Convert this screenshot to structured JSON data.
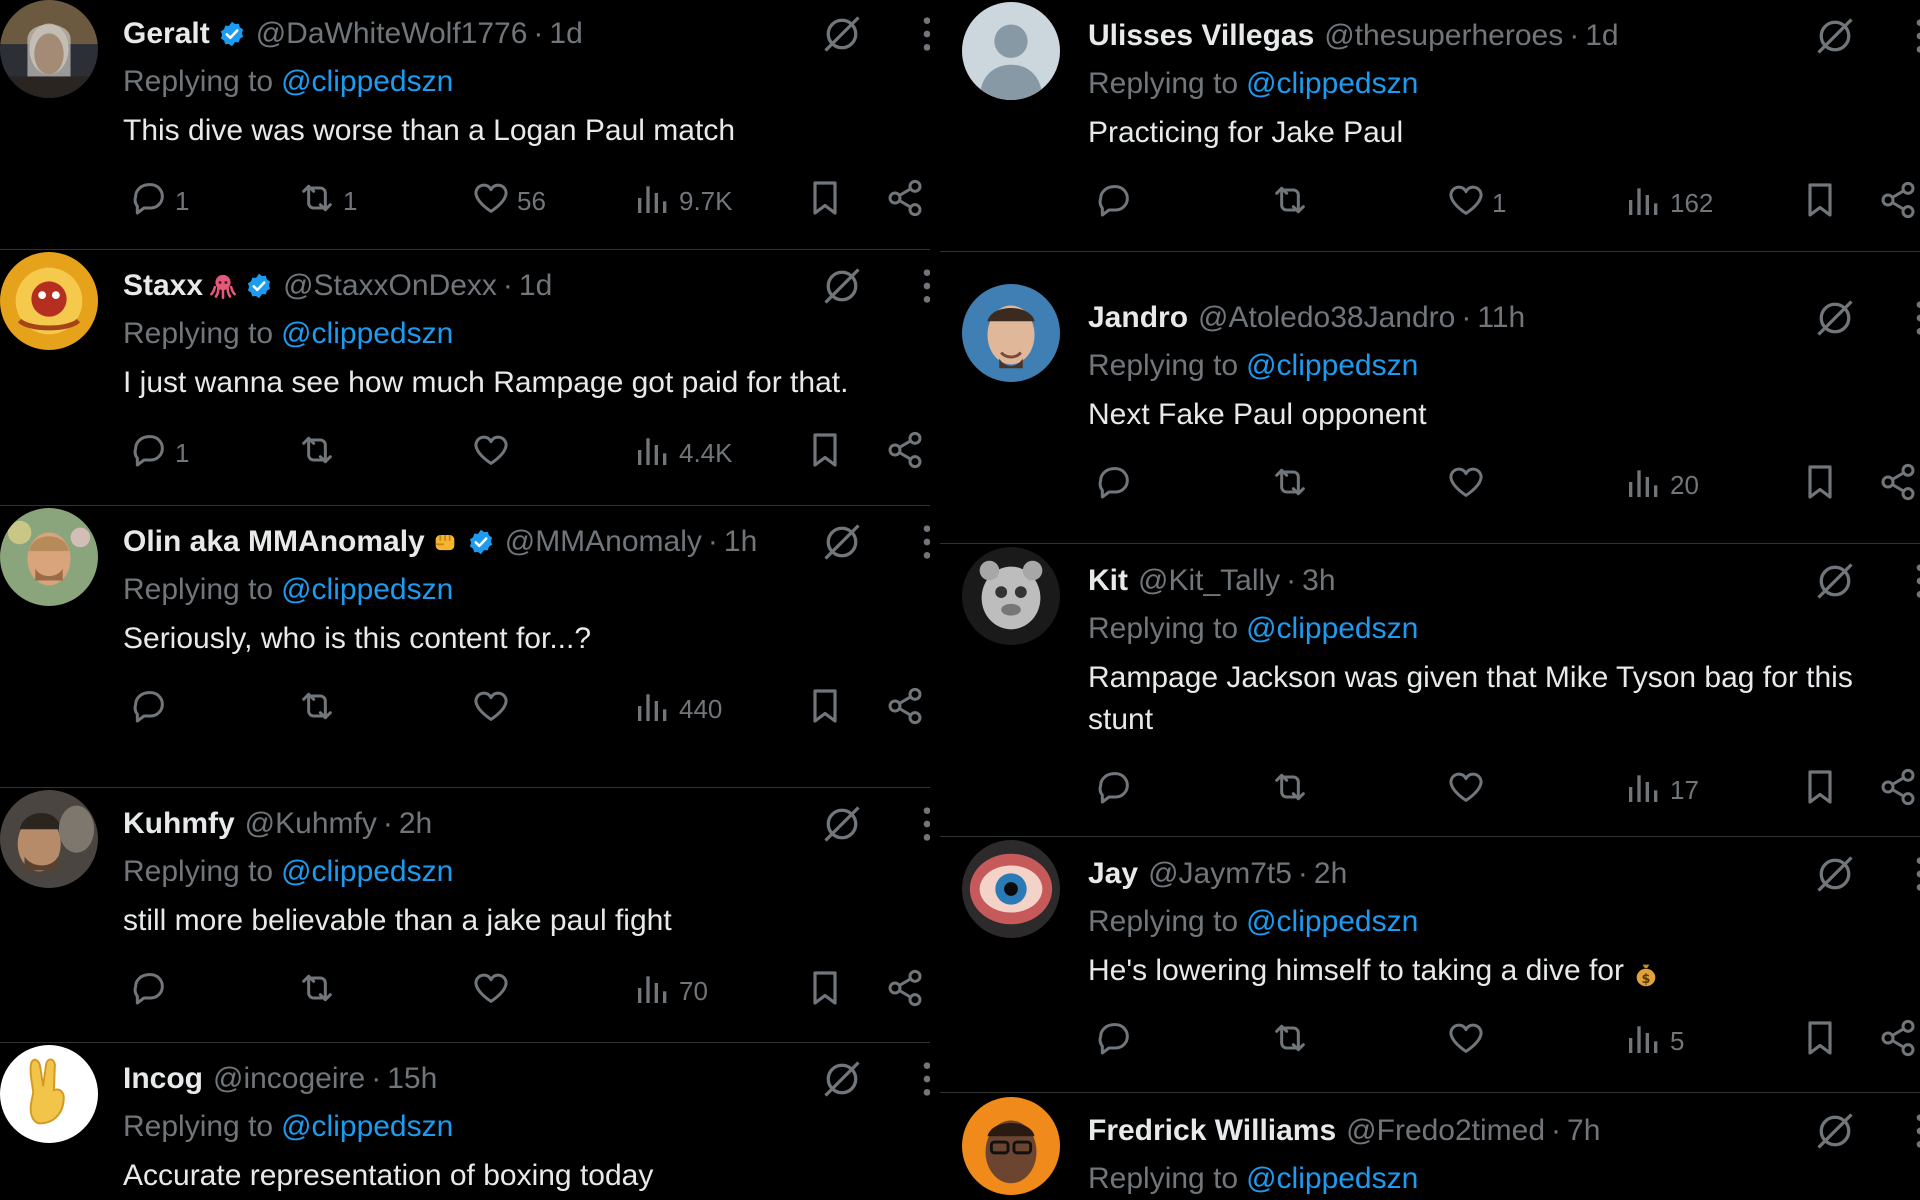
{
  "reply_prefix": "Replying to",
  "left_column": [
    {
      "name": "Geralt",
      "verified": true,
      "emoji": "",
      "handle": "@DaWhiteWolf1776",
      "time": "1d",
      "mention": "@clippedszn",
      "text": "This dive was worse than a Logan Paul match",
      "replies": "1",
      "reposts": "1",
      "likes": "56",
      "views": "9.7K",
      "avatar": "geralt"
    },
    {
      "name": "Staxx",
      "verified": true,
      "emoji": "octopus",
      "handle": "@StaxxOnDexx",
      "time": "1d",
      "mention": "@clippedszn",
      "text": "I just wanna see how much Rampage got paid for that.",
      "replies": "1",
      "reposts": "",
      "likes": "",
      "views": "4.4K",
      "avatar": "staxx"
    },
    {
      "name": "Olin aka MMAnomaly",
      "verified": true,
      "emoji": "fist",
      "handle": "@MMAnomaly",
      "time": "1h",
      "mention": "@clippedszn",
      "text": "Seriously, who is this content for...?",
      "replies": "",
      "reposts": "",
      "likes": "",
      "views": "440",
      "avatar": "olin"
    },
    {
      "name": "Kuhmfy",
      "verified": false,
      "emoji": "",
      "handle": "@Kuhmfy",
      "time": "2h",
      "mention": "@clippedszn",
      "text": "still more believable than a jake paul fight",
      "replies": "",
      "reposts": "",
      "likes": "",
      "views": "70",
      "avatar": "kuhmfy"
    },
    {
      "name": "Incog",
      "verified": false,
      "emoji": "",
      "handle": "@incogeire",
      "time": "15h",
      "mention": "@clippedszn",
      "text": "Accurate representation of boxing today",
      "replies": "",
      "reposts": "",
      "likes": "",
      "views": "",
      "avatar": "incog"
    }
  ],
  "right_column": [
    {
      "name": "Ulisses Villegas",
      "verified": false,
      "emoji": "",
      "handle": "@thesuperheroes",
      "time": "1d",
      "mention": "@clippedszn",
      "text": "Practicing for Jake Paul",
      "replies": "",
      "reposts": "",
      "likes": "1",
      "views": "162",
      "avatar": "default"
    },
    {
      "name": "Jandro",
      "verified": false,
      "emoji": "",
      "handle": "@Atoledo38Jandro",
      "time": "11h",
      "mention": "@clippedszn",
      "text": "Next Fake Paul opponent",
      "replies": "",
      "reposts": "",
      "likes": "",
      "views": "20",
      "avatar": "jandro"
    },
    {
      "name": "Kit",
      "verified": false,
      "emoji": "",
      "handle": "@Kit_Tally",
      "time": "3h",
      "mention": "@clippedszn",
      "text": "Rampage Jackson was given that Mike Tyson bag for this stunt",
      "replies": "",
      "reposts": "",
      "likes": "",
      "views": "17",
      "avatar": "kit"
    },
    {
      "name": "Jay",
      "verified": false,
      "emoji": "",
      "handle": "@Jaym7t5",
      "time": "2h",
      "mention": "@clippedszn",
      "text": "He's lowering himself to taking a dive for",
      "trailing_emoji": "money-bag",
      "replies": "",
      "reposts": "",
      "likes": "",
      "views": "5",
      "avatar": "jay"
    },
    {
      "name": "Fredrick Williams",
      "verified": false,
      "emoji": "",
      "handle": "@Fredo2timed",
      "time": "7h",
      "mention": "@clippedszn",
      "text": "",
      "replies": "",
      "reposts": "",
      "likes": "",
      "views": "",
      "avatar": "fredrick"
    }
  ],
  "colors": {
    "background": "#000000",
    "text": "#e7e9ea",
    "muted": "#71767b",
    "link": "#1d9bf0",
    "separator": "#2f3336"
  }
}
